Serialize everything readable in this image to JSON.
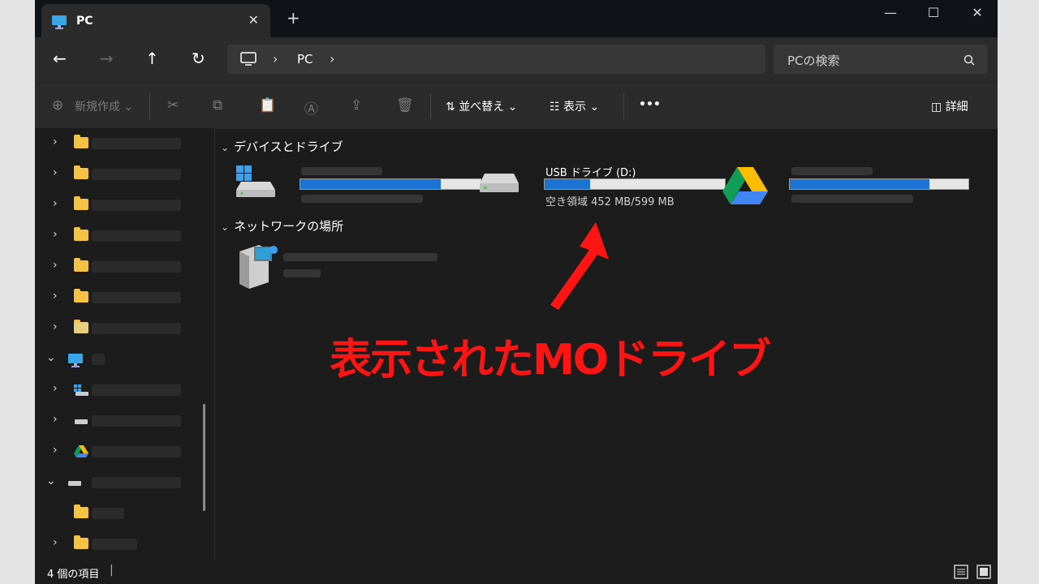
{
  "window": {
    "tab_title": "PC",
    "tab_close": "✕",
    "new_tab": "+",
    "minimize": "—",
    "maximize": "☐",
    "close": "✕"
  },
  "nav": {
    "breadcrumb": [
      "PC"
    ],
    "search_placeholder": "PCの検索"
  },
  "toolbar": {
    "new_label": "新規作成",
    "sort_label": "並べ替え",
    "view_label": "表示",
    "more_label": "•••",
    "details_label": "詳細"
  },
  "content": {
    "groups": [
      {
        "title": "デバイスとドライブ"
      },
      {
        "title": "ネットワークの場所"
      }
    ],
    "drives": [
      {
        "name": "",
        "free": "",
        "used_fraction": 0.78,
        "icon": "windows-disk-icon"
      },
      {
        "name": "USB ドライブ (D:)",
        "free": "空き領域 452 MB/599 MB",
        "used_fraction": 0.25,
        "icon": "drive-icon"
      },
      {
        "name": "",
        "free": "",
        "used_fraction": 0.78,
        "icon": "google-drive-icon"
      }
    ],
    "network_location": {
      "name": "",
      "icon": "media-server-icon"
    }
  },
  "annotation": {
    "text": "表示されたMOドライブ",
    "color": "#ff1414"
  },
  "status": {
    "count": "4 個の項目",
    "sep": "|"
  },
  "colors": {
    "accent": "#1b74d4",
    "annotation": "#ff1414",
    "folder": "#f6c244"
  }
}
